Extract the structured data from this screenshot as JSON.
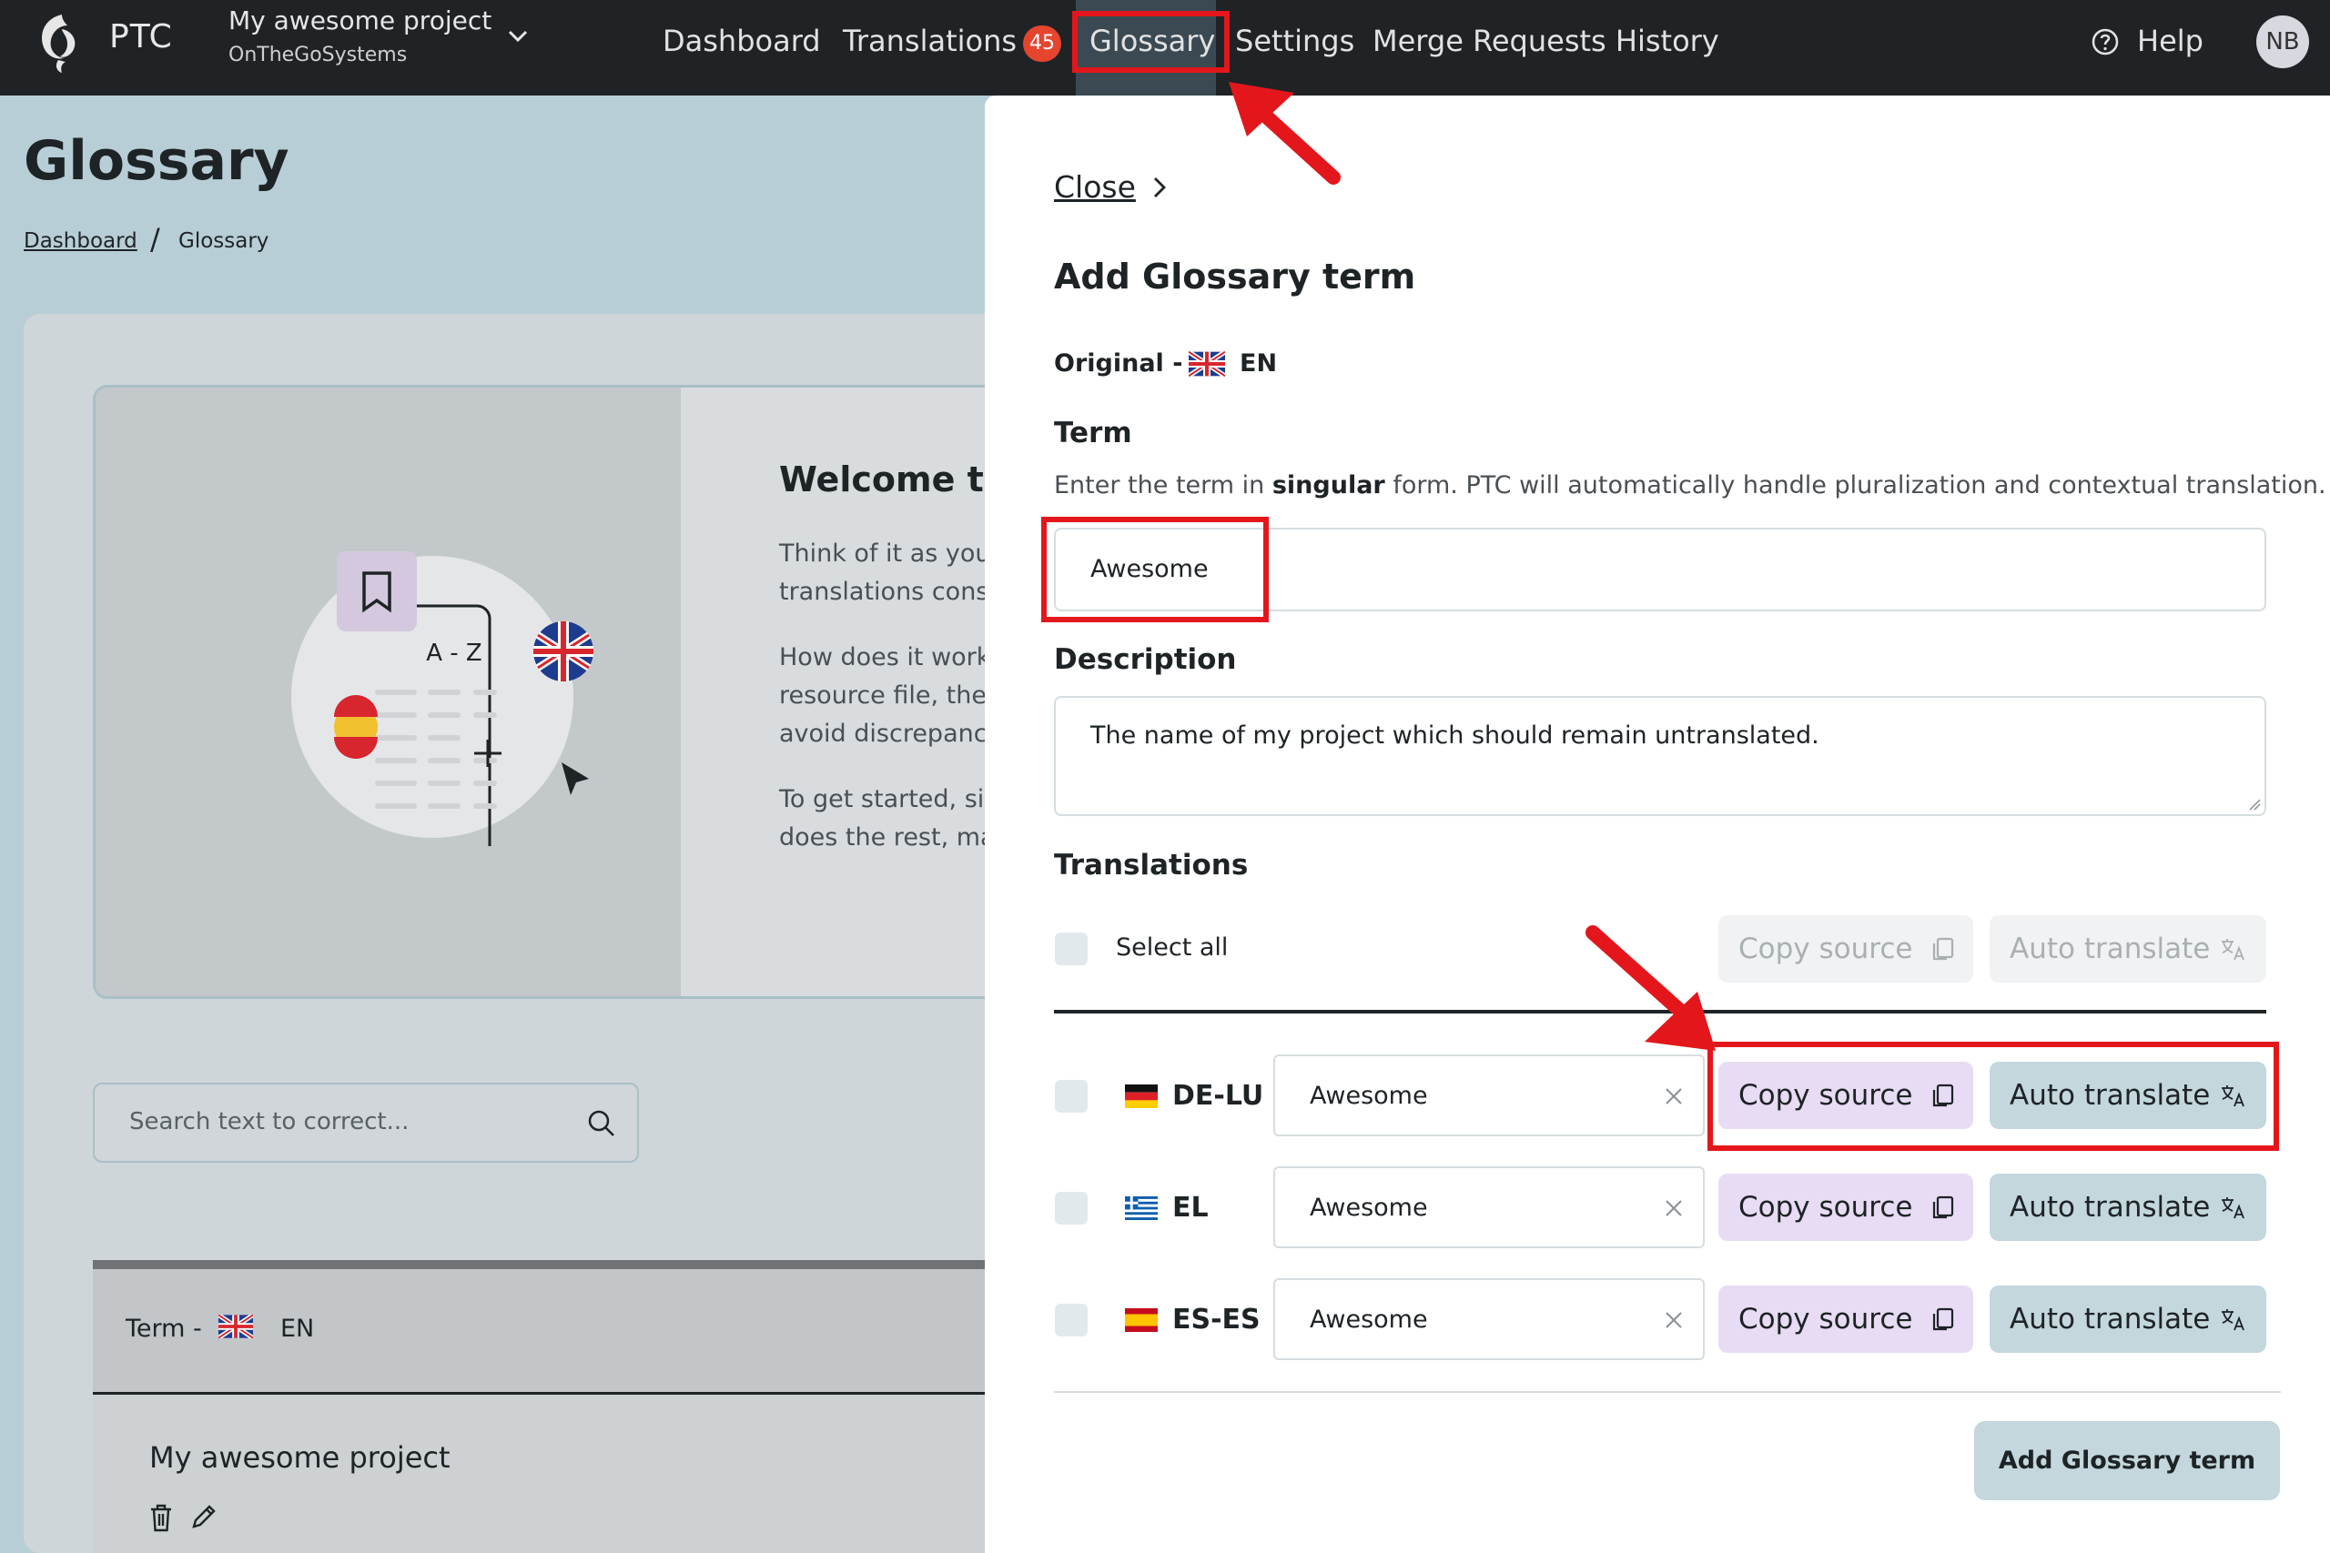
{
  "topbar": {
    "brand": "PTC",
    "project_name": "My awesome project",
    "project_org": "OnTheGoSystems",
    "nav": [
      {
        "label": "Dashboard"
      },
      {
        "label": "Translations",
        "badge": "45"
      },
      {
        "label": "Glossary",
        "active": true
      },
      {
        "label": "Settings"
      },
      {
        "label": "Merge Requests History"
      }
    ],
    "help_label": "Help",
    "avatar_initials": "NB",
    "colors": {
      "bar": "#1f2326",
      "badge": "#e5452f"
    }
  },
  "page": {
    "title": "Glossary",
    "breadcrumb": [
      {
        "label": "Dashboard"
      },
      {
        "label": "Glossary"
      }
    ],
    "welcome": {
      "title": "Welcome to",
      "lines": [
        "Think of it as your",
        "translations cons",
        "How does it work?",
        "resource file, the",
        "avoid discrepanc",
        "To get started, sir",
        "does the rest, ma"
      ],
      "illustration_label": "A - Z"
    },
    "search": {
      "placeholder": "Search text to correct..."
    },
    "table": {
      "header_term": "Term -",
      "header_lang": "EN",
      "rows": [
        {
          "term": "My awesome project"
        }
      ]
    }
  },
  "panel": {
    "close_label": "Close",
    "title": "Add Glossary term",
    "original_label": "Original -",
    "original_lang": "EN",
    "term_label": "Term",
    "term_help_before": "Enter the term in ",
    "term_help_bold": "singular",
    "term_help_after": " form. PTC will automatically handle pluralization and contextual translation.",
    "term_value": "Awesome",
    "description_label": "Description",
    "description_value": "The name of my project which should remain untranslated.",
    "translations_label": "Translations",
    "select_all_label": "Select all",
    "copy_source_label": "Copy source",
    "auto_translate_label": "Auto translate",
    "translations": [
      {
        "lang": "DE-LU",
        "value": "Awesome"
      },
      {
        "lang": "EL",
        "value": "Awesome"
      },
      {
        "lang": "ES-ES",
        "value": "Awesome"
      }
    ],
    "add_button_label": "Add Glossary term",
    "colors": {
      "copy_btn": "#e7dcf3",
      "auto_btn": "#c3d7dc",
      "annotation": "#e3171b"
    }
  }
}
